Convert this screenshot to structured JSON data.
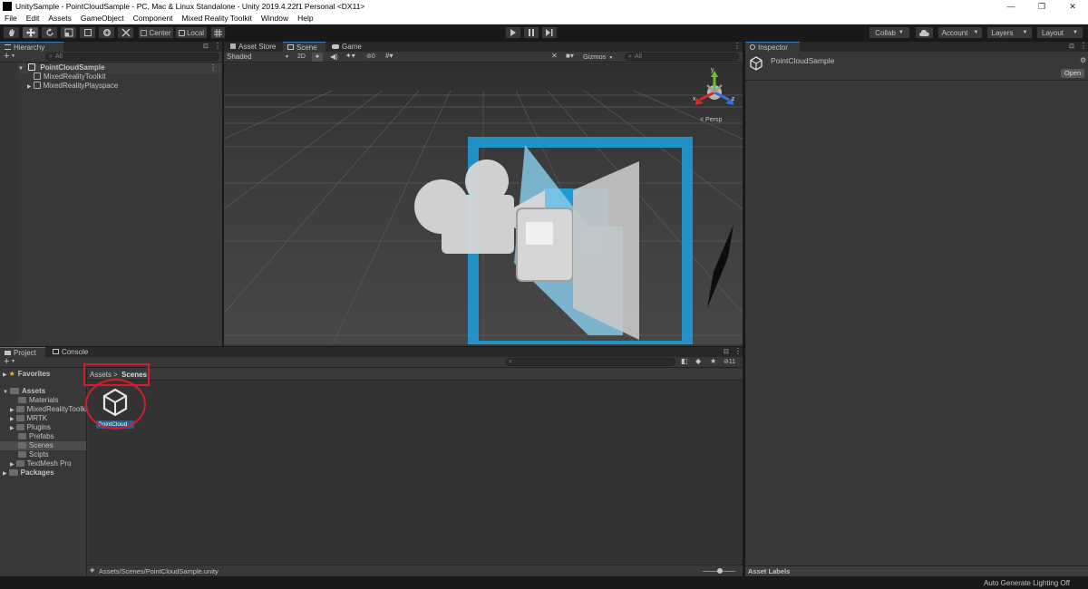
{
  "window": {
    "title": "UnitySample - PointCloudSample - PC, Mac & Linux Standalone - Unity 2019.4.22f1 Personal <DX11>",
    "minimize": "—",
    "restore": "❐",
    "close": "✕"
  },
  "menu": [
    "File",
    "Edit",
    "Assets",
    "GameObject",
    "Component",
    "Mixed Reality Toolkit",
    "Window",
    "Help"
  ],
  "toolbar": {
    "pivot_label": "Center",
    "space_label": "Local",
    "collab_label": "Collab",
    "account_label": "Account",
    "layers_label": "Layers",
    "layout_label": "Layout"
  },
  "hierarchy": {
    "tab_label": "Hierarchy",
    "search_placeholder": "All",
    "scene_name": "PointCloudSample",
    "children": [
      "MixedRealityToolkit",
      "MixedRealityPlayspace"
    ]
  },
  "scene_view": {
    "tabs": [
      "Asset Store",
      "Scene",
      "Game"
    ],
    "shading": "Shaded",
    "mode_2d": "2D",
    "hidden_count": "0",
    "gizmos": "Gizmos",
    "search_placeholder": "All",
    "persp_label": "Persp",
    "axis_x": "x",
    "axis_y": "y",
    "axis_z": "z"
  },
  "inspector": {
    "tab_label": "Inspector",
    "object_name": "PointCloudSample",
    "open_button": "Open",
    "asset_labels": "Asset Labels"
  },
  "project": {
    "tabs": [
      "Project",
      "Console"
    ],
    "favorites_label": "Favorites",
    "assets_label": "Assets",
    "folders": [
      "Materials",
      "MixedRealityToolkit",
      "MRTK",
      "Plugins",
      "Prefabs",
      "Scenes",
      "Scipts",
      "TextMesh Pro"
    ],
    "selected_folder": "Scenes",
    "packages_label": "Packages",
    "breadcrumb": [
      "Assets",
      "Scenes"
    ],
    "hidden_count": "11",
    "asset_item_label": "PointCloud...",
    "status_path": "Assets/Scenes/PointCloudSample.unity"
  },
  "statusbar": {
    "text": "Auto Generate Lighting Off"
  },
  "colors": {
    "accent_blue": "#3a79bb",
    "annotation_red": "#d11f2a",
    "panel_bg": "#383838",
    "dark_bg": "#191919"
  }
}
